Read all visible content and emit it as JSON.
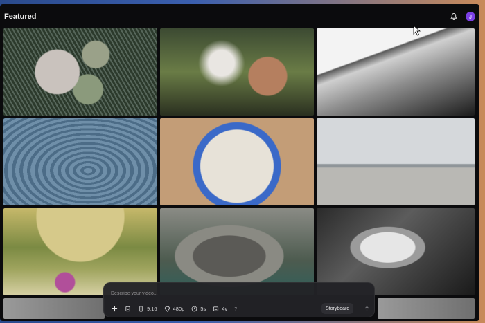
{
  "header": {
    "title": "Featured",
    "avatar_initial": "J",
    "bell_icon": "bell-icon"
  },
  "gallery": {
    "tiles": [
      {
        "name": "cactus-tile"
      },
      {
        "name": "girl-tile"
      },
      {
        "name": "bw-branch-tile"
      },
      {
        "name": "water-ripple-tile"
      },
      {
        "name": "coffee-boat-tile"
      },
      {
        "name": "beach-piano-tile"
      },
      {
        "name": "butterfly-tile"
      },
      {
        "name": "monkey-tile"
      },
      {
        "name": "flower-tile"
      }
    ]
  },
  "composer": {
    "placeholder": "Describe your video...",
    "aspect_ratio": "9:16",
    "resolution": "480p",
    "duration": "5s",
    "variations": "4v",
    "help": "?",
    "storyboard_label": "Storyboard"
  },
  "colors": {
    "avatar": "#7b3fe4",
    "background": "#0b0b0d"
  }
}
